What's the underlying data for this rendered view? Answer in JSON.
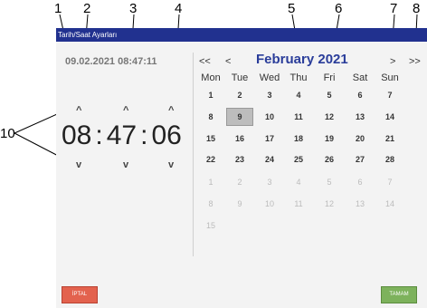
{
  "callouts": [
    "1",
    "2",
    "3",
    "4",
    "5",
    "6",
    "7",
    "8",
    "10"
  ],
  "window": {
    "title": "Tarih/Saat Ayarları"
  },
  "current_datetime": "09.02.2021 08:47:11",
  "clock": {
    "hour": "08",
    "minute": "47",
    "second": "06",
    "sep": ":",
    "up": "^",
    "down": "v"
  },
  "calendar": {
    "prev_year": "<<",
    "prev_month": "<",
    "next_month": ">",
    "next_year": ">>",
    "month_label": "February 2021",
    "weekdays": [
      "Mon",
      "Tue",
      "Wed",
      "Thu",
      "Fri",
      "Sat",
      "Sun"
    ],
    "weeks": [
      [
        "1",
        "2",
        "3",
        "4",
        "5",
        "6",
        "7"
      ],
      [
        "8",
        "9",
        "10",
        "11",
        "12",
        "13",
        "14"
      ],
      [
        "15",
        "16",
        "17",
        "18",
        "19",
        "20",
        "21"
      ],
      [
        "22",
        "23",
        "24",
        "25",
        "26",
        "27",
        "28"
      ],
      [
        "1",
        "2",
        "3",
        "4",
        "5",
        "6",
        "7"
      ],
      [
        "8",
        "9",
        "10",
        "11",
        "12",
        "13",
        "14"
      ],
      [
        "15"
      ]
    ],
    "selected_day": "9"
  },
  "buttons": {
    "cancel": "İPTAL",
    "ok": "TAMAM"
  },
  "colors": {
    "titlebar": "#21318f",
    "cancel": "#e3624e",
    "ok": "#7db25c"
  }
}
